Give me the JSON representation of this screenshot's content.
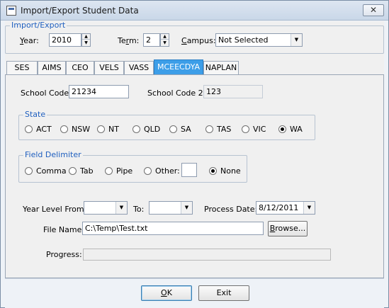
{
  "window": {
    "title": "Import/Export Student Data",
    "close_glyph": "✕"
  },
  "import_export": {
    "group_title": "Import/Export",
    "year": {
      "label_pre": "",
      "label_u": "Y",
      "label_post": "ear:",
      "value": "2010"
    },
    "term": {
      "label_pre": "Te",
      "label_u": "r",
      "label_post": "m:",
      "value": "2"
    },
    "campus": {
      "label_pre": "",
      "label_u": "C",
      "label_post": "ampus:",
      "value": "Not Selected"
    }
  },
  "tabs": [
    {
      "label": "SES"
    },
    {
      "label": "AIMS"
    },
    {
      "label": "CEO"
    },
    {
      "label": "VELS"
    },
    {
      "label": "VASS"
    },
    {
      "label": "MCEECDYA"
    },
    {
      "label": "NAPLAN"
    }
  ],
  "active_tab": "MCEECDYA",
  "school": {
    "code_label": "School Code:",
    "code_value": "21234",
    "code2_label": "School Code 2:",
    "code2_value": "123"
  },
  "state": {
    "group_title": "State",
    "options": [
      "ACT",
      "NSW",
      "NT",
      "QLD",
      "SA",
      "TAS",
      "VIC",
      "WA"
    ],
    "selected": "WA"
  },
  "delimiter": {
    "group_title": "Field Delimiter",
    "options": [
      "Comma",
      "Tab",
      "Pipe",
      "Other:",
      "None"
    ],
    "selected": "None",
    "other_value": ""
  },
  "year_level": {
    "from_label": "Year Level From:",
    "from_value": "",
    "to_label": "To:",
    "to_value": ""
  },
  "process_date": {
    "label": "Process Date:",
    "value": "8/12/2011"
  },
  "file": {
    "label": "File Name:",
    "value": "C:\\Temp\\Test.txt",
    "browse_pre": "",
    "browse_u": "B",
    "browse_post": "rowse..."
  },
  "progress": {
    "label": "Progress:",
    "value_percent": 0
  },
  "buttons": {
    "ok_u": "O",
    "ok_post": "K",
    "exit_label": "Exit"
  },
  "colors": {
    "accent": "#3d9ee8",
    "group_title": "#1f5fbf"
  },
  "icons": {
    "spin_up": "▲",
    "spin_down": "▼",
    "dropdown": "▼"
  }
}
